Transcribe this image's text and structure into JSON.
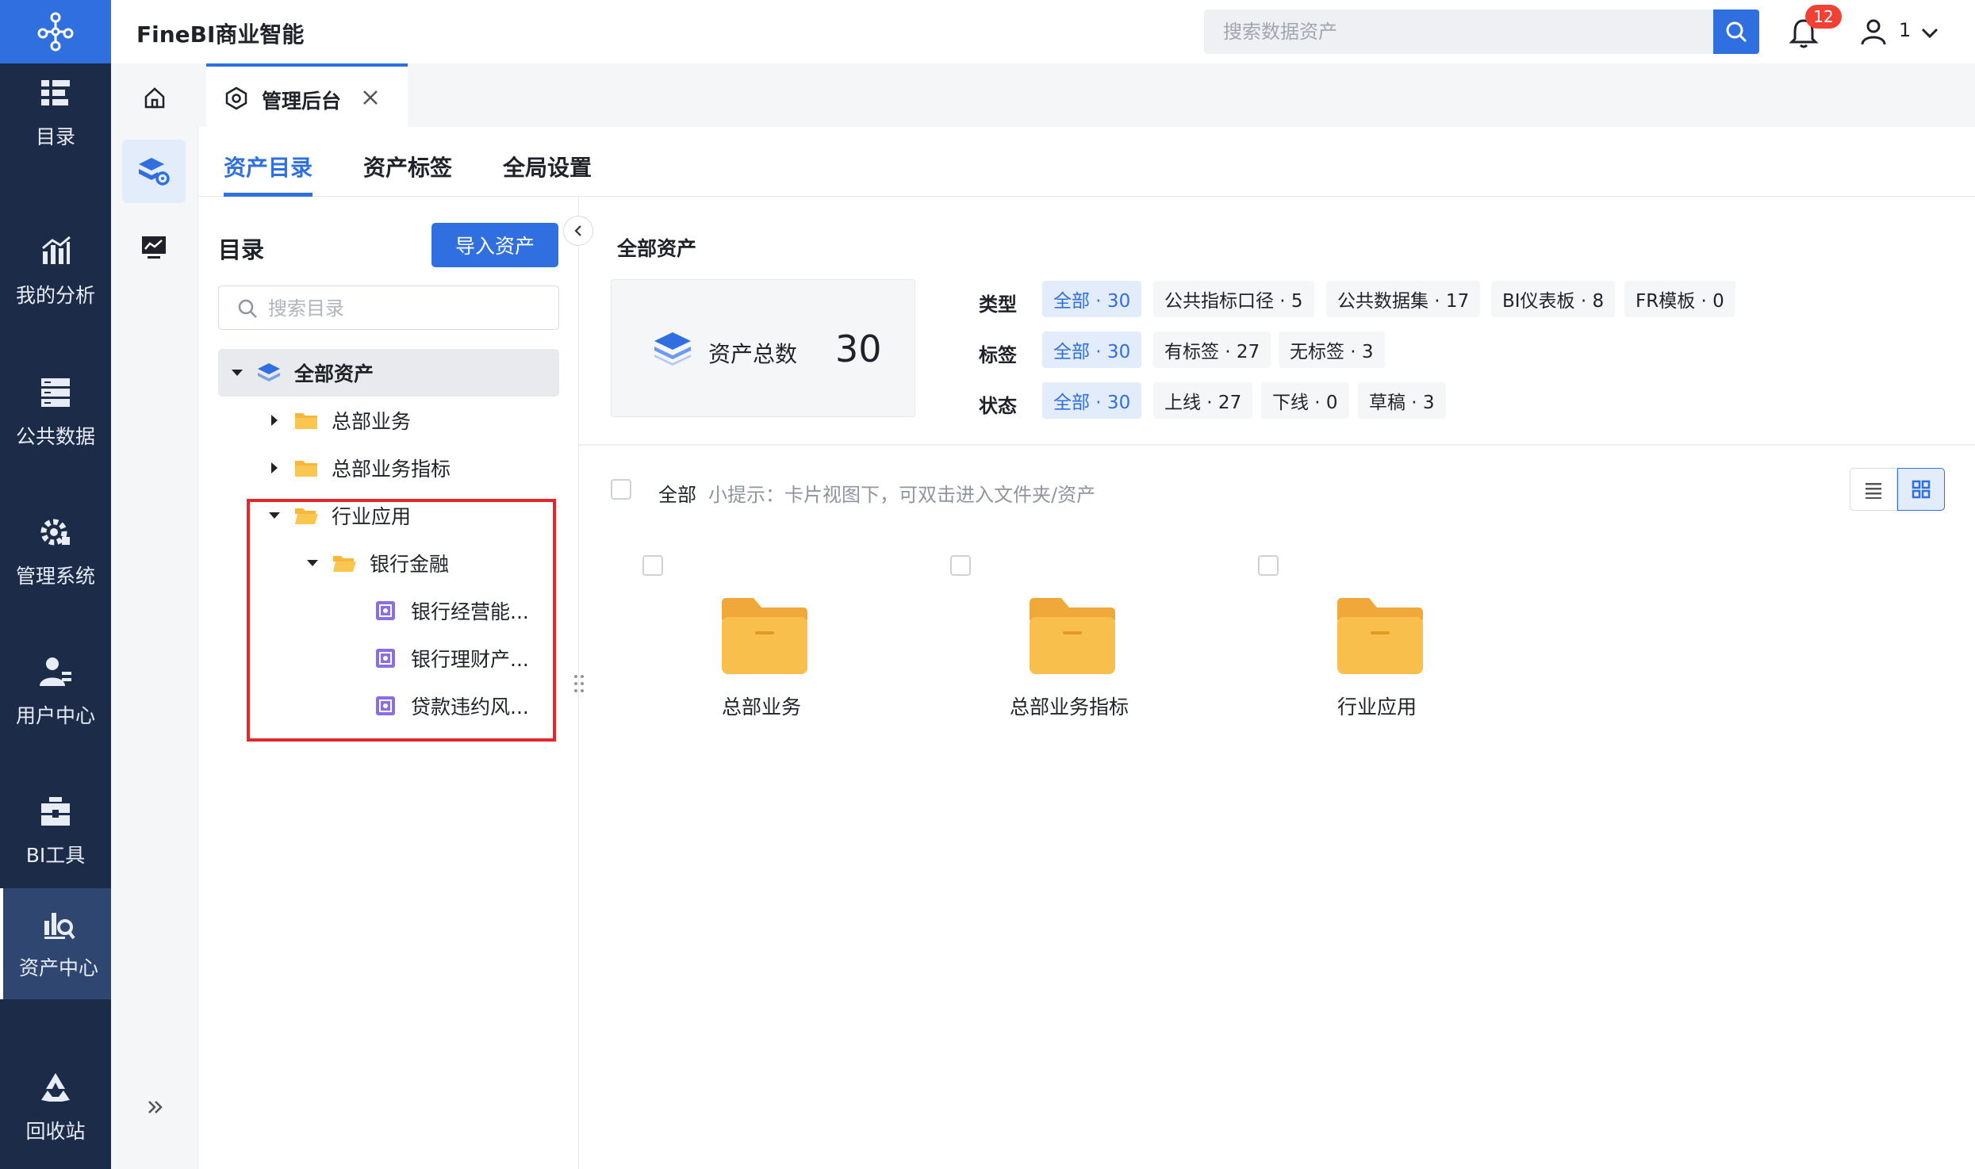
{
  "app": {
    "title": "FineBI商业智能"
  },
  "search": {
    "placeholder": "搜索数据资产"
  },
  "notifications": {
    "count": "12"
  },
  "user": {
    "name": "1"
  },
  "leftnav": {
    "items": [
      {
        "label": "目录",
        "icon": "catalog-icon"
      },
      {
        "label": "我的分析",
        "icon": "analysis-icon"
      },
      {
        "label": "公共数据",
        "icon": "database-icon"
      },
      {
        "label": "管理系统",
        "icon": "gear-icon"
      },
      {
        "label": "用户中心",
        "icon": "user-icon"
      },
      {
        "label": "BI工具",
        "icon": "toolbox-icon"
      },
      {
        "label": "资产中心",
        "icon": "asset-center-icon",
        "active": true
      },
      {
        "label": "回收站",
        "icon": "recycle-icon"
      }
    ]
  },
  "tabs": {
    "home_icon": "home-icon",
    "active_tab": "管理后台"
  },
  "toptabs": [
    {
      "label": "资产目录",
      "active": true
    },
    {
      "label": "资产标签"
    },
    {
      "label": "全局设置"
    }
  ],
  "directory": {
    "title": "目录",
    "import_button": "导入资产",
    "search_placeholder": "搜索目录",
    "tree": {
      "root": "全部资产",
      "hq_business": "总部业务",
      "hq_metrics": "总部业务指标",
      "industry": "行业应用",
      "banking": "银行金融",
      "bank_ops": "银行经营能...",
      "bank_wealth": "银行理财产...",
      "loan_risk": "贷款违约风..."
    }
  },
  "main": {
    "title": "全部资产",
    "total": {
      "label": "资产总数",
      "value": "30"
    },
    "filters": {
      "type": {
        "label": "类型",
        "chips": [
          "全部 · 30",
          "公共指标口径 · 5",
          "公共数据集 · 17",
          "BI仪表板 · 8",
          "FR模板 · 0"
        ]
      },
      "tag": {
        "label": "标签",
        "chips": [
          "全部 · 30",
          "有标签 · 27",
          "无标签 · 3"
        ]
      },
      "status": {
        "label": "状态",
        "chips": [
          "全部 · 30",
          "上线 · 27",
          "下线 · 0",
          "草稿 · 3"
        ]
      }
    },
    "select_all": "全部",
    "tip": "小提示：卡片视图下，可双击进入文件夹/资产",
    "cards": [
      {
        "label": "总部业务"
      },
      {
        "label": "总部业务指标"
      },
      {
        "label": "行业应用"
      }
    ]
  },
  "colors": {
    "primary": "#2f6fe0",
    "nav_bg": "#1b2b48",
    "folder": "#f6b73c",
    "highlight": "#e0282e",
    "badge": "#f04134"
  }
}
